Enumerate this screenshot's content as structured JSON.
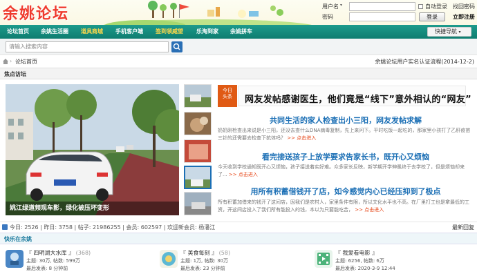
{
  "header": {
    "logo": "余姚论坛",
    "username_label": "用户名",
    "password_label": "密码",
    "auto_login": "自动登录",
    "find_password": "找回密码",
    "login_button": "登录",
    "register": "立即注册"
  },
  "nav": {
    "items": [
      "论坛首页",
      "余姚生活圈",
      "道具商城",
      "手机客户端",
      "签到领威望",
      "乐淘到家",
      "余姚拼车"
    ],
    "quick_nav": "快捷导航"
  },
  "search": {
    "placeholder": "请输入搜索内容"
  },
  "breadcrumb": {
    "separator": "›",
    "current": "论坛首页",
    "notice": "余姚论坛用户实名认证流程(2014-12-2)"
  },
  "focus": {
    "title": "焦点访坛",
    "slide_caption": "姚江绿道频现车影，绿化被压坏变形",
    "headline_badge_1": "今日",
    "headline_badge_2": "头条",
    "headline": "网友发帖感谢医生，他们竟是“线下”意外相认的“网友”",
    "news": [
      {
        "title": "共同生活的家人检查出小三阳，网友发帖求解",
        "summary": "奶奶刚检查出来说是小三阳，还没去查什么DNA病毒复制，先上来问下。平时吃饭一起吃的，那家里小孩打了乙肝疫苗三针的还需要去检查下抗体吗？",
        "more": ">> 点击进入"
      },
      {
        "title": "看完接送孩子上放学要求告家长书，既开心又烦恼",
        "summary": "今天收到学校通知既开心又烦恼，孩子接送着实好难。众多家长反映，新学期开学伸冕终于去学校了，但是烦恼却来了...",
        "more": ">> 点击进入"
      },
      {
        "title": "用所有积蓄借钱开了店，如今感觉内心已经压抑到了极点",
        "summary": "所有积蓄加借来的钱开了这间店，因我们是农村人，家里条件有限，所以文化水平也不高。在厂里打工也是拿最低的工资，开这间店投入了我们所有能投入的钱，本以为只要能吃苦，",
        "more": ">> 点击进入"
      }
    ]
  },
  "stats": {
    "text": "今日: 2526 | 昨日: 3758 | 帖子: 21986255 | 会员: 602597 | 欢迎新会员: 杨潘江",
    "latest_reply": "最新回复"
  },
  "forums": {
    "title": "快乐在余姚",
    "items": [
      {
        "name": "『 四明湖大水库 』",
        "count": "(368)",
        "stats": "主题: 30万, 帖数: 599万",
        "last": "最后发表: 8 分钟前",
        "icon_color": "#4a86c5"
      },
      {
        "name": "『 美食每刻 』",
        "count": "(58)",
        "stats": "主题: 1万, 帖数: 30万",
        "last": "最后发表: 23 分钟前",
        "icon_color": "#5cb8d4"
      },
      {
        "name": "『 我爱看电影 』",
        "count": "",
        "stats": "主题: 6256, 帖数: 6万",
        "last": "最后发表: 2020-3-9 12:44",
        "icon_color": "#4cb37a"
      }
    ]
  },
  "colors": {
    "nav": "#0e7d70",
    "accent": "#e05a14",
    "link": "#1b6fb5"
  }
}
